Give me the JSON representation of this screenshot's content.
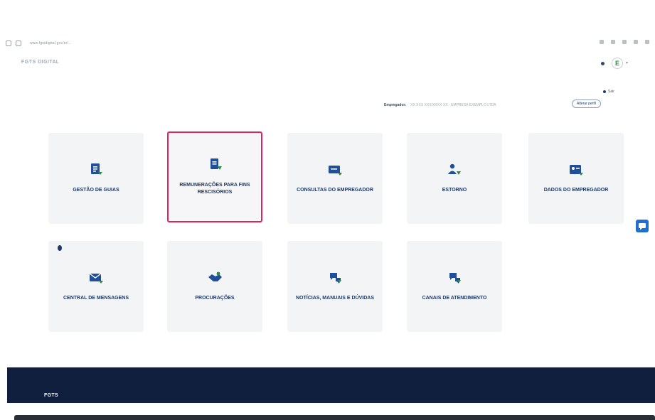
{
  "browser": {
    "url": "www.fgtsdigital.gov.br/..."
  },
  "header": {
    "brand": "FGTS DIGITAL",
    "avatar_letter": "E"
  },
  "logout_label": "Sair",
  "employer": {
    "label": "Empregador:",
    "value": "XX.XXX.XXX/XXXX-XX - EMPRESA EXEMPLO LTDA",
    "change_button": "Alterar perfil"
  },
  "cards": [
    {
      "label": "Gestão de Guias",
      "icon": "document-list-icon"
    },
    {
      "label": "Remunerações para fins rescisórios",
      "icon": "document-money-icon"
    },
    {
      "label": "Consultas do Empregador",
      "icon": "id-card-icon"
    },
    {
      "label": "Estorno",
      "icon": "person-refund-icon"
    },
    {
      "label": "Dados do Empregador",
      "icon": "employer-card-icon"
    },
    {
      "label": "Central de Mensagens",
      "icon": "envelope-icon"
    },
    {
      "label": "Procurações",
      "icon": "handshake-icon"
    },
    {
      "label": "Notícias, Manuais e Dúvidas",
      "icon": "chat-bubbles-icon"
    },
    {
      "label": "Canais de Atendimento",
      "icon": "support-chat-icon"
    }
  ],
  "selected_card": "Remunerações para fins rescisórios",
  "footer": {
    "logo": "FGTS"
  },
  "colors": {
    "primary": "#1f3a66",
    "accent_green": "#2e8b3e",
    "selection": "#e0245e",
    "footer": "#0f1f3d",
    "card_bg": "#f3f4f6"
  }
}
